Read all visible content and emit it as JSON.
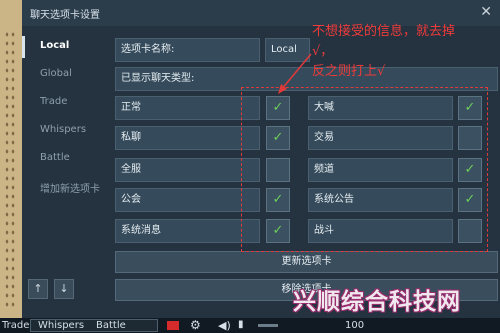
{
  "window": {
    "title": "聊天选项卡设置",
    "close_glyph": "✕"
  },
  "sidebar": {
    "items": [
      {
        "label": "Local",
        "active": true
      },
      {
        "label": "Global"
      },
      {
        "label": "Trade"
      },
      {
        "label": "Whispers"
      },
      {
        "label": "Battle"
      },
      {
        "label": "增加新选项卡"
      }
    ],
    "up_glyph": "↑",
    "down_glyph": "↓"
  },
  "form": {
    "tab_name_label": "选项卡名称:",
    "tab_name_value": "Local",
    "shown_types_label": "已显示聊天类型:"
  },
  "channels_left": [
    {
      "label": "正常",
      "checked": true
    },
    {
      "label": "私聊",
      "checked": true
    },
    {
      "label": "全服",
      "checked": false
    },
    {
      "label": "公会",
      "checked": true
    },
    {
      "label": "系统消息",
      "checked": true
    }
  ],
  "channels_right": [
    {
      "label": "大喊",
      "checked": true
    },
    {
      "label": "交易",
      "checked": false
    },
    {
      "label": "频道",
      "checked": true
    },
    {
      "label": "系统公告",
      "checked": true
    },
    {
      "label": "战斗",
      "checked": false
    }
  ],
  "buttons": {
    "update": "更新选项卡",
    "remove": "移除选项卡"
  },
  "annotation": {
    "line1": "不想接受的信息，就去掉",
    "line2": "√，",
    "line3": "反之则打上√",
    "color": "#ee3b3b"
  },
  "bottom_bar": {
    "left_label": "Trade",
    "tab1": "Whispers",
    "tab2": "Battle",
    "number": "100"
  },
  "watermark": "兴顺综合科技网",
  "colors": {
    "check": "#6dce5a",
    "panel": "#24333f",
    "field": "#354a5a"
  }
}
